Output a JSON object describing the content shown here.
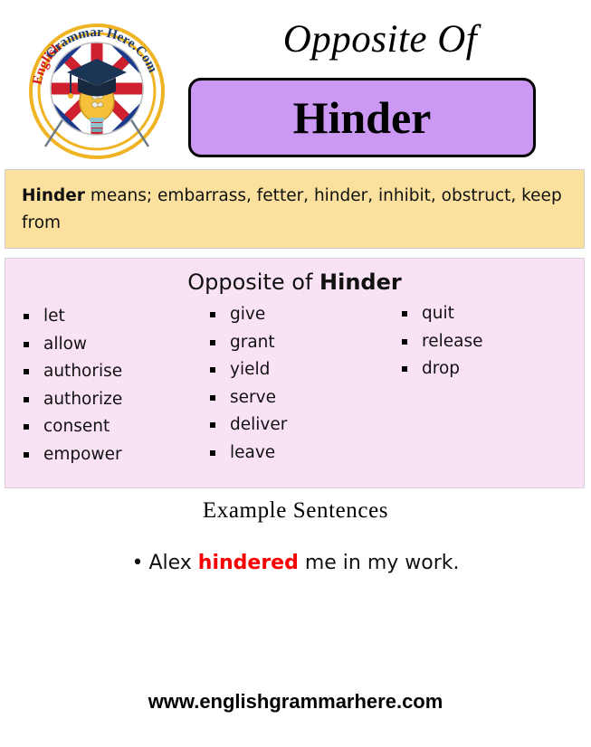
{
  "header": {
    "title": "Opposite Of",
    "word": "Hinder",
    "logo": {
      "name": "english-grammar-here-logo",
      "text_top": "English Grammar",
      "text_bottom": "Here.Com",
      "full_text": "English Grammar Here.Com",
      "ring_color": "#f0b323",
      "text_color": "#d11a1a",
      "text_color_secondary": "#1b3a6b",
      "flag_colors": {
        "red": "#cf2030",
        "blue": "#1b3a8c",
        "white": "#ffffff"
      },
      "cap_color": "#1b3557",
      "bulb_color": "#f6c03a"
    }
  },
  "meaning": {
    "word": "Hinder",
    "lead": "means;",
    "synonyms": "embarrass, fetter, hinder, inhibit, obstruct, keep from",
    "full_text": "Hinder means; embarrass, fetter, hinder, inhibit, obstruct, keep from",
    "background": "#fbe09e"
  },
  "opposites": {
    "title_prefix": "Opposite of ",
    "title_word": "Hinder",
    "background": "#fae2f5",
    "columns": [
      {
        "items": [
          "let",
          "allow",
          "authorise",
          "authorize",
          "consent",
          "empower"
        ]
      },
      {
        "items": [
          "give",
          "grant",
          "yield",
          "serve",
          "deliver",
          "leave"
        ]
      },
      {
        "items": [
          "quit",
          "release",
          "drop"
        ]
      }
    ]
  },
  "examples": {
    "title": "Example  Sentences",
    "items": [
      {
        "bullet": "•",
        "before": "Alex ",
        "highlight": "hindered",
        "after": " me in my work.",
        "full_text": "Alex hindered me in my work.",
        "highlight_color": "#fb0000"
      }
    ]
  },
  "footer": {
    "url": "www.englishgrammarhere.com"
  }
}
